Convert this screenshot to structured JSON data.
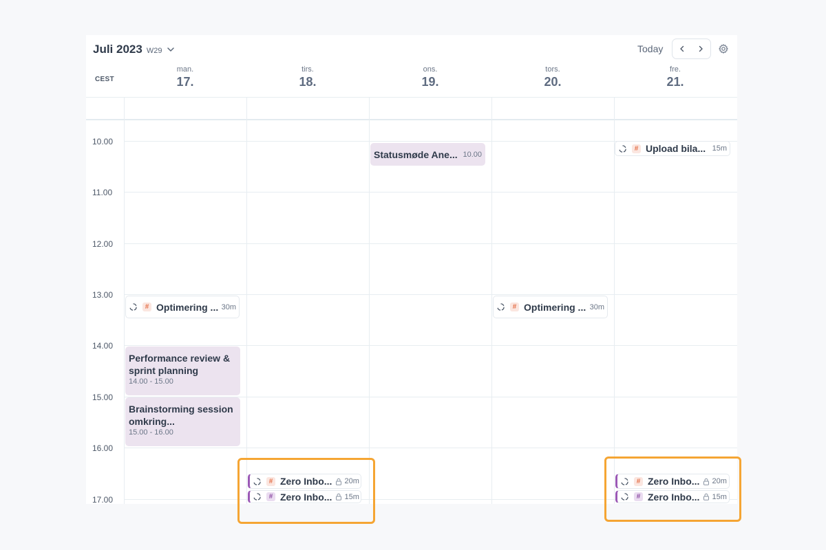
{
  "header": {
    "month_label": "Juli 2023",
    "week_label": "W29",
    "today_label": "Today",
    "timezone_label": "CEST"
  },
  "days": [
    {
      "name": "man.",
      "number": "17."
    },
    {
      "name": "tirs.",
      "number": "18."
    },
    {
      "name": "ons.",
      "number": "19."
    },
    {
      "name": "tors.",
      "number": "20."
    },
    {
      "name": "fre.",
      "number": "21."
    }
  ],
  "hours": [
    "10.00",
    "11.00",
    "12.00",
    "13.00",
    "14.00",
    "15.00",
    "16.00",
    "17.00"
  ],
  "events": {
    "statusmode": {
      "title": "Statusmøde Ane...",
      "time": "10.00"
    },
    "performance": {
      "title": "Performance review & sprint planning",
      "time": "14.00 - 15.00"
    },
    "brainstorm": {
      "title": "Brainstorming session omkring...",
      "time": "15.00 - 16.00"
    }
  },
  "tasks": {
    "optimering_mon": {
      "title": "Optimering ...",
      "duration": "30m",
      "tag_icon": "hash-icon"
    },
    "optimering_thu": {
      "title": "Optimering ...",
      "duration": "30m",
      "tag_icon": "hash-icon"
    },
    "upload_fri": {
      "title": "Upload bila...",
      "duration": "15m",
      "tag_icon": "hash-icon"
    },
    "zero_tue_1": {
      "title": "Zero Inbo...",
      "duration": "20m",
      "tag_icon": "hash-icon"
    },
    "zero_tue_2": {
      "title": "Zero Inbo...",
      "duration": "15m",
      "tag_icon": "hash-icon"
    },
    "zero_fri_1": {
      "title": "Zero Inbo...",
      "duration": "20m",
      "tag_icon": "hash-icon"
    },
    "zero_fri_2": {
      "title": "Zero Inbo...",
      "duration": "15m",
      "tag_icon": "hash-icon"
    }
  },
  "colors": {
    "accent_highlight": "#f5a533",
    "meeting_bg": "#ece3ef",
    "tag_orange": "#e5734d",
    "tag_purple": "#8e4fa5",
    "task_bar": "#9b59b6"
  }
}
